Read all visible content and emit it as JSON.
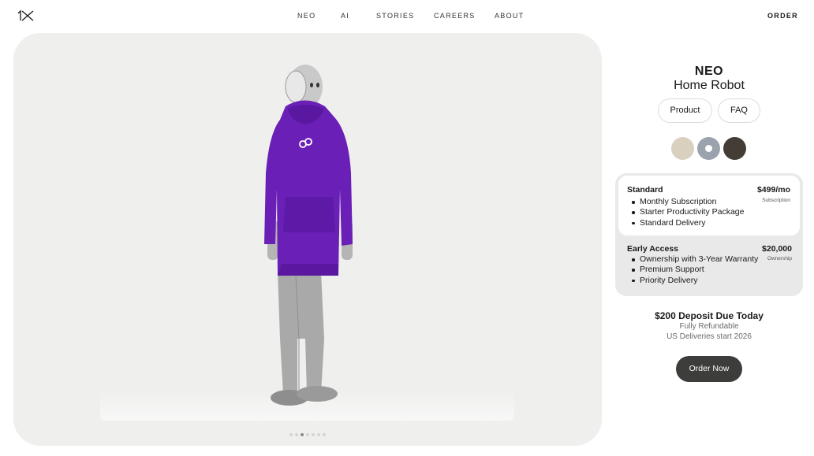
{
  "header": {
    "logo_alt": "1X",
    "nav": [
      "NEO",
      "AI",
      "STORIES",
      "CAREERS",
      "ABOUT"
    ],
    "order_label": "ORDER"
  },
  "hero": {
    "carousel_count": 7,
    "carousel_active": 3
  },
  "product": {
    "name": "NEO",
    "subtitle": "Home Robot",
    "tabs": [
      "Product",
      "FAQ"
    ],
    "colors": [
      {
        "name": "beige",
        "hex": "#d9d0c0"
      },
      {
        "name": "gray-blue",
        "hex": "#9aa3ad",
        "selected": true
      },
      {
        "name": "dark-brown",
        "hex": "#433d36"
      }
    ]
  },
  "plans": [
    {
      "name": "Standard",
      "price": "$499/mo",
      "price_type": "Subscription",
      "features": [
        "Monthly Subscription",
        "Starter Productivity Package",
        "Standard Delivery"
      ],
      "selected": true
    },
    {
      "name": "Early Access",
      "price": "$20,000",
      "price_type": "Ownership",
      "features": [
        "Ownership with 3-Year Warranty",
        "Premium Support",
        "Priority Delivery"
      ],
      "selected": false
    }
  ],
  "checkout": {
    "deposit": "$200 Deposit Due Today",
    "refundable": "Fully Refundable",
    "deliveries": "US Deliveries start 2026",
    "order_button": "Order Now"
  },
  "colors": {
    "hoodie": "#6a1fb6",
    "hero_bg": "#efefee",
    "button_bg": "#3d3d3b"
  }
}
